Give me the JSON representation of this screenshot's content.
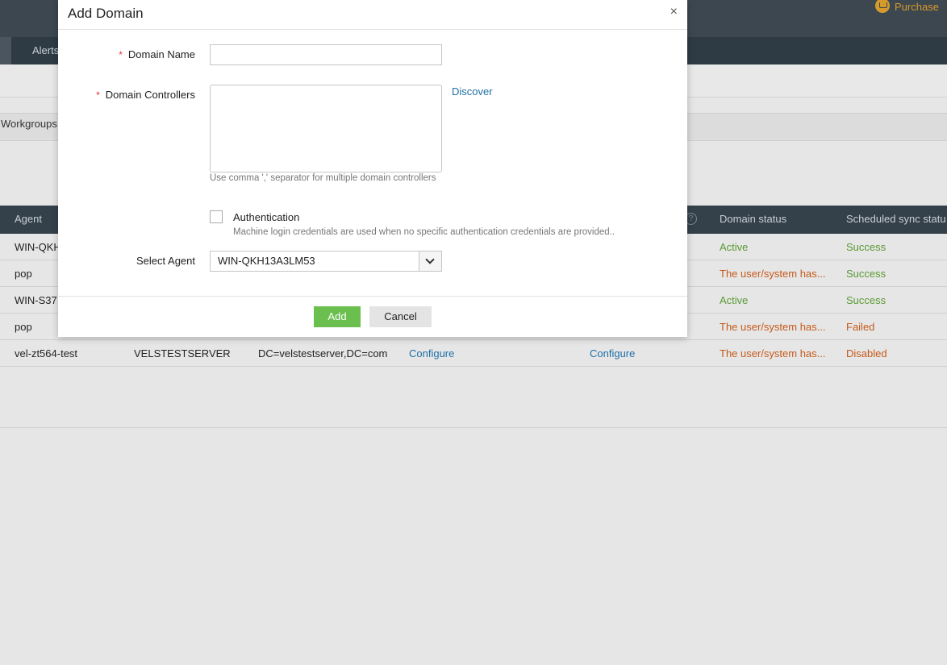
{
  "background": {
    "nav_tab": "Alerts",
    "purchase_label": "Purchase",
    "workgroups_tab": "Workgroups",
    "table": {
      "headers": [
        "Agent",
        "Domain status",
        "Scheduled sync statu"
      ],
      "rows": [
        {
          "agent": "WIN-QKH",
          "server": "",
          "dn": "",
          "cfg1": "",
          "cfg2": "",
          "status": "Active",
          "sync": "Success"
        },
        {
          "agent": "pop",
          "server": "",
          "dn": "",
          "cfg1": "",
          "cfg2": "",
          "status": "The user/system has...",
          "sync": "Success"
        },
        {
          "agent": "WIN-S37",
          "server": "",
          "dn": "",
          "cfg1": "",
          "cfg2": "",
          "status": "Active",
          "sync": "Success"
        },
        {
          "agent": "pop",
          "server": "",
          "dn": "",
          "cfg1": "",
          "cfg2": "",
          "status": "The user/system has...",
          "sync": "Failed"
        },
        {
          "agent": "vel-zt564-test",
          "server": "VELSTESTSERVER",
          "dn": "DC=velstestserver,DC=com",
          "cfg1": "Configure",
          "cfg2": "Configure",
          "status": "The user/system has...",
          "sync": "Disabled"
        }
      ]
    }
  },
  "modal": {
    "title": "Add Domain",
    "close_symbol": "×",
    "required_mark": "*",
    "domain_name_label": "Domain Name",
    "domain_name_value": "",
    "domain_controllers_label": "Domain Controllers",
    "domain_controllers_value": "",
    "discover_link": "Discover",
    "controllers_hint": "Use comma ',' separator for multiple domain controllers",
    "authentication_label": "Authentication",
    "authentication_checked": false,
    "authentication_hint": "Machine login credentials are used when no specific authentication credentials are provided..",
    "select_agent_label": "Select Agent",
    "select_agent_value": "WIN-QKH13A3LM53",
    "add_button": "Add",
    "cancel_button": "Cancel"
  },
  "colors": {
    "active": "#5a9a34",
    "warning": "#c55a1a",
    "link": "#1f6fa6",
    "add_button": "#6bbf4e",
    "header_dark": "#35414a"
  }
}
